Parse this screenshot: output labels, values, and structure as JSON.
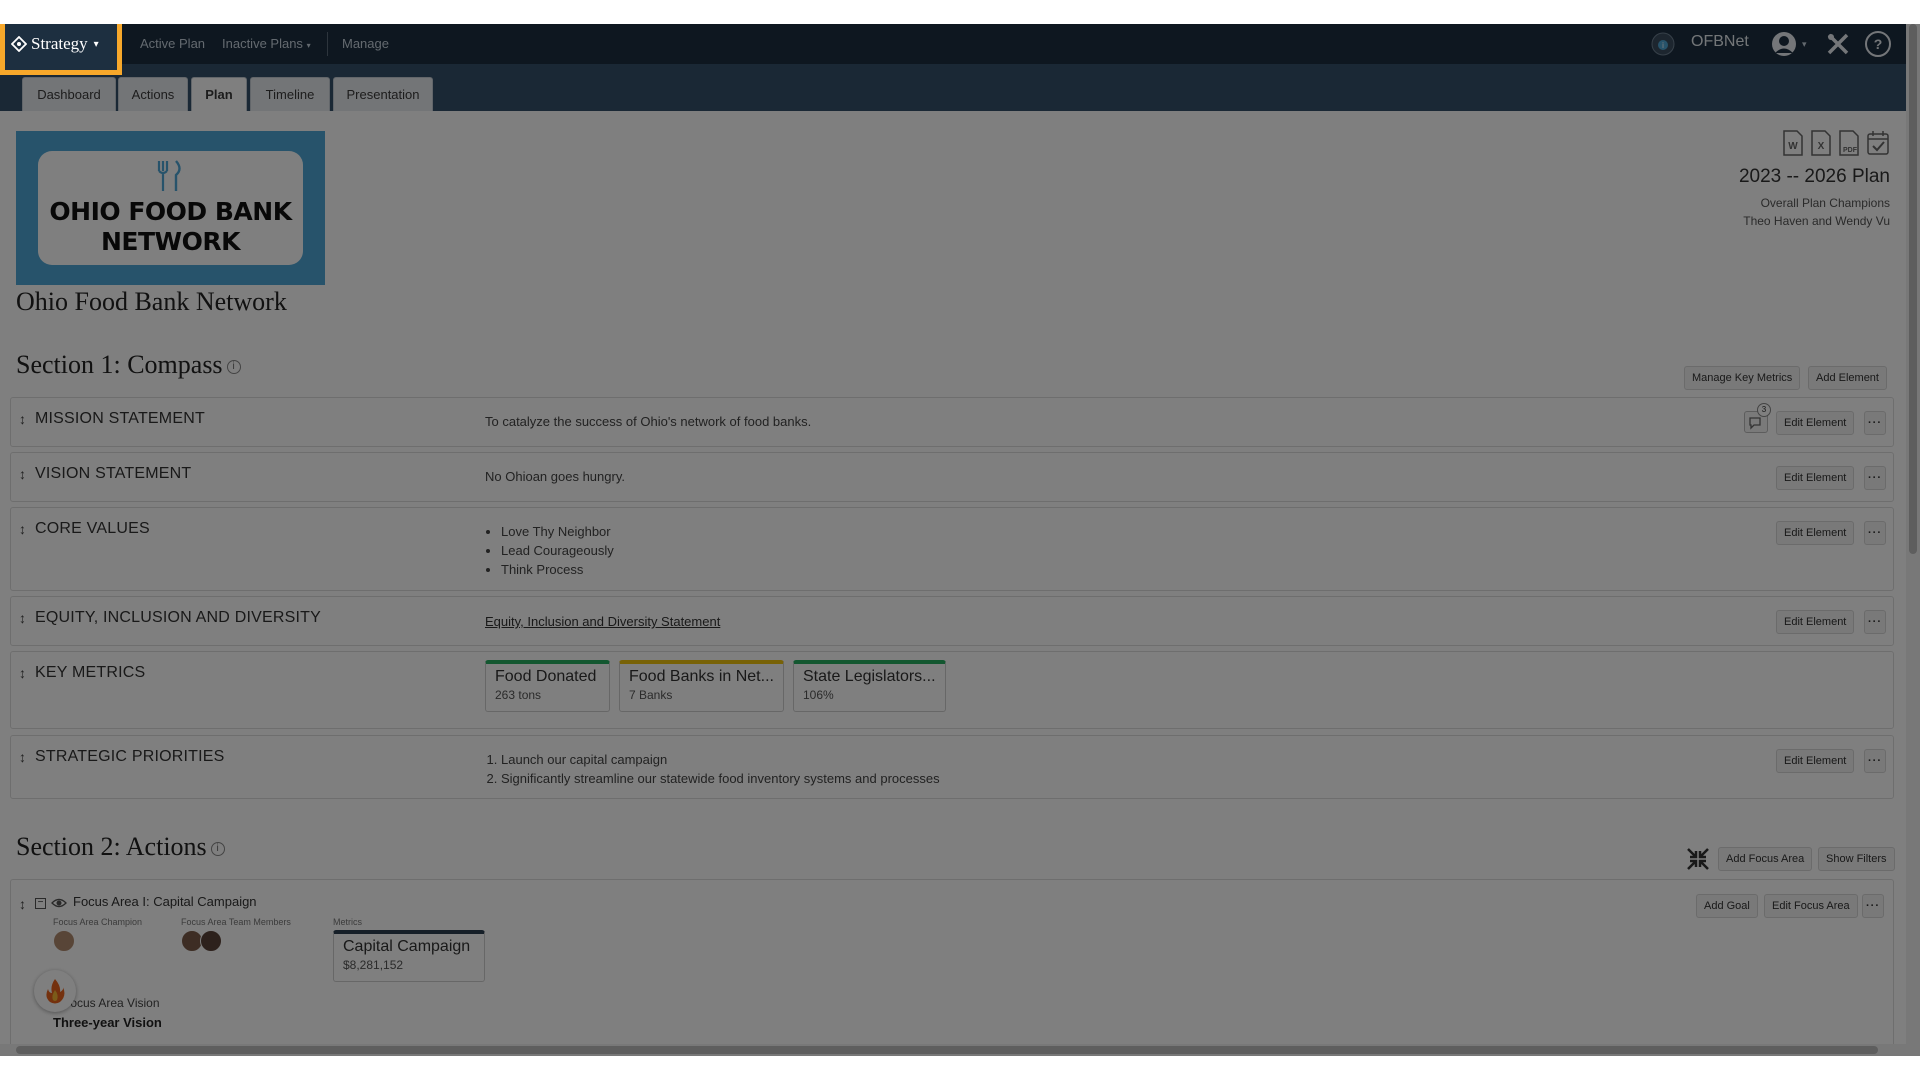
{
  "topbar": {
    "brand": "Strategy",
    "nav": [
      "Active Plan",
      "Inactive Plans",
      "Manage"
    ],
    "org_code": "OFBNet"
  },
  "tabs": [
    "Dashboard",
    "Actions",
    "Plan",
    "Timeline",
    "Presentation"
  ],
  "active_tab": "Plan",
  "logo": {
    "line1": "OHIO FOOD BANK",
    "line2": "NETWORK"
  },
  "org_name": "Ohio Food Bank Network",
  "plan": {
    "title": "2023 -- 2026 Plan",
    "champions_label": "Overall Plan Champions",
    "champions": "Theo Haven and Wendy Vu"
  },
  "section1": {
    "title": "Section 1: Compass",
    "manage_metrics": "Manage Key Metrics",
    "add_element": "Add Element",
    "edit_label": "Edit Element",
    "comment_count": "3",
    "mission": {
      "label": "MISSION STATEMENT",
      "value": "To catalyze the success of Ohio's network of food banks."
    },
    "vision": {
      "label": "VISION STATEMENT",
      "value": "No Ohioan goes hungry."
    },
    "core_values": {
      "label": "CORE VALUES",
      "items": [
        "Love Thy Neighbor",
        "Lead Courageously",
        "Think Process"
      ]
    },
    "equity": {
      "label": "EQUITY, INCLUSION AND DIVERSITY",
      "link": "Equity, Inclusion and Diversity Statement"
    },
    "key_metrics": {
      "label": "KEY METRICS",
      "cards": [
        {
          "name": "Food Donated",
          "value": "263 tons",
          "color": "#27ae60"
        },
        {
          "name": "Food Banks in Net...",
          "value": "7 Banks",
          "color": "#f1c40f"
        },
        {
          "name": "State Legislators...",
          "value": "106%",
          "color": "#27ae60"
        }
      ]
    },
    "priorities": {
      "label": "STRATEGIC PRIORITIES",
      "items": [
        "Launch our capital campaign",
        "Significantly streamline our statewide food inventory systems and processes"
      ]
    }
  },
  "section2": {
    "title": "Section 2: Actions",
    "add_focus": "Add Focus Area",
    "show_filters": "Show Filters",
    "focus": {
      "title": "Focus Area I: Capital Campaign",
      "add_goal": "Add Goal",
      "edit_focus": "Edit Focus Area",
      "champion_label": "Focus Area Champion",
      "team_label": "Focus Area Team Members",
      "metrics_label": "Metrics",
      "metric": {
        "name": "Capital Campaign",
        "value": "$8,281,152",
        "color": "#2c3e50"
      },
      "vision_label": "Focus Area Vision",
      "vision_title": "Three-year Vision"
    }
  },
  "colors": {
    "topbar": "#1d2f40",
    "tabband": "#34506a",
    "highlight": "#f7a82b",
    "logo_blue": "#4ea7d6"
  }
}
